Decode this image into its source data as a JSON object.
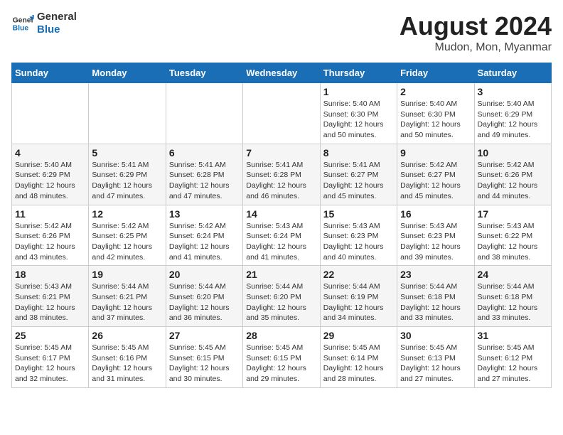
{
  "header": {
    "logo_general": "General",
    "logo_blue": "Blue",
    "month_year": "August 2024",
    "location": "Mudon, Mon, Myanmar"
  },
  "days_of_week": [
    "Sunday",
    "Monday",
    "Tuesday",
    "Wednesday",
    "Thursday",
    "Friday",
    "Saturday"
  ],
  "weeks": [
    [
      {
        "day": "",
        "info": ""
      },
      {
        "day": "",
        "info": ""
      },
      {
        "day": "",
        "info": ""
      },
      {
        "day": "",
        "info": ""
      },
      {
        "day": "1",
        "info": "Sunrise: 5:40 AM\nSunset: 6:30 PM\nDaylight: 12 hours\nand 50 minutes."
      },
      {
        "day": "2",
        "info": "Sunrise: 5:40 AM\nSunset: 6:30 PM\nDaylight: 12 hours\nand 50 minutes."
      },
      {
        "day": "3",
        "info": "Sunrise: 5:40 AM\nSunset: 6:29 PM\nDaylight: 12 hours\nand 49 minutes."
      }
    ],
    [
      {
        "day": "4",
        "info": "Sunrise: 5:40 AM\nSunset: 6:29 PM\nDaylight: 12 hours\nand 48 minutes."
      },
      {
        "day": "5",
        "info": "Sunrise: 5:41 AM\nSunset: 6:29 PM\nDaylight: 12 hours\nand 47 minutes."
      },
      {
        "day": "6",
        "info": "Sunrise: 5:41 AM\nSunset: 6:28 PM\nDaylight: 12 hours\nand 47 minutes."
      },
      {
        "day": "7",
        "info": "Sunrise: 5:41 AM\nSunset: 6:28 PM\nDaylight: 12 hours\nand 46 minutes."
      },
      {
        "day": "8",
        "info": "Sunrise: 5:41 AM\nSunset: 6:27 PM\nDaylight: 12 hours\nand 45 minutes."
      },
      {
        "day": "9",
        "info": "Sunrise: 5:42 AM\nSunset: 6:27 PM\nDaylight: 12 hours\nand 45 minutes."
      },
      {
        "day": "10",
        "info": "Sunrise: 5:42 AM\nSunset: 6:26 PM\nDaylight: 12 hours\nand 44 minutes."
      }
    ],
    [
      {
        "day": "11",
        "info": "Sunrise: 5:42 AM\nSunset: 6:26 PM\nDaylight: 12 hours\nand 43 minutes."
      },
      {
        "day": "12",
        "info": "Sunrise: 5:42 AM\nSunset: 6:25 PM\nDaylight: 12 hours\nand 42 minutes."
      },
      {
        "day": "13",
        "info": "Sunrise: 5:42 AM\nSunset: 6:24 PM\nDaylight: 12 hours\nand 41 minutes."
      },
      {
        "day": "14",
        "info": "Sunrise: 5:43 AM\nSunset: 6:24 PM\nDaylight: 12 hours\nand 41 minutes."
      },
      {
        "day": "15",
        "info": "Sunrise: 5:43 AM\nSunset: 6:23 PM\nDaylight: 12 hours\nand 40 minutes."
      },
      {
        "day": "16",
        "info": "Sunrise: 5:43 AM\nSunset: 6:23 PM\nDaylight: 12 hours\nand 39 minutes."
      },
      {
        "day": "17",
        "info": "Sunrise: 5:43 AM\nSunset: 6:22 PM\nDaylight: 12 hours\nand 38 minutes."
      }
    ],
    [
      {
        "day": "18",
        "info": "Sunrise: 5:43 AM\nSunset: 6:21 PM\nDaylight: 12 hours\nand 38 minutes."
      },
      {
        "day": "19",
        "info": "Sunrise: 5:44 AM\nSunset: 6:21 PM\nDaylight: 12 hours\nand 37 minutes."
      },
      {
        "day": "20",
        "info": "Sunrise: 5:44 AM\nSunset: 6:20 PM\nDaylight: 12 hours\nand 36 minutes."
      },
      {
        "day": "21",
        "info": "Sunrise: 5:44 AM\nSunset: 6:20 PM\nDaylight: 12 hours\nand 35 minutes."
      },
      {
        "day": "22",
        "info": "Sunrise: 5:44 AM\nSunset: 6:19 PM\nDaylight: 12 hours\nand 34 minutes."
      },
      {
        "day": "23",
        "info": "Sunrise: 5:44 AM\nSunset: 6:18 PM\nDaylight: 12 hours\nand 33 minutes."
      },
      {
        "day": "24",
        "info": "Sunrise: 5:44 AM\nSunset: 6:18 PM\nDaylight: 12 hours\nand 33 minutes."
      }
    ],
    [
      {
        "day": "25",
        "info": "Sunrise: 5:45 AM\nSunset: 6:17 PM\nDaylight: 12 hours\nand 32 minutes."
      },
      {
        "day": "26",
        "info": "Sunrise: 5:45 AM\nSunset: 6:16 PM\nDaylight: 12 hours\nand 31 minutes."
      },
      {
        "day": "27",
        "info": "Sunrise: 5:45 AM\nSunset: 6:15 PM\nDaylight: 12 hours\nand 30 minutes."
      },
      {
        "day": "28",
        "info": "Sunrise: 5:45 AM\nSunset: 6:15 PM\nDaylight: 12 hours\nand 29 minutes."
      },
      {
        "day": "29",
        "info": "Sunrise: 5:45 AM\nSunset: 6:14 PM\nDaylight: 12 hours\nand 28 minutes."
      },
      {
        "day": "30",
        "info": "Sunrise: 5:45 AM\nSunset: 6:13 PM\nDaylight: 12 hours\nand 27 minutes."
      },
      {
        "day": "31",
        "info": "Sunrise: 5:45 AM\nSunset: 6:12 PM\nDaylight: 12 hours\nand 27 minutes."
      }
    ]
  ]
}
